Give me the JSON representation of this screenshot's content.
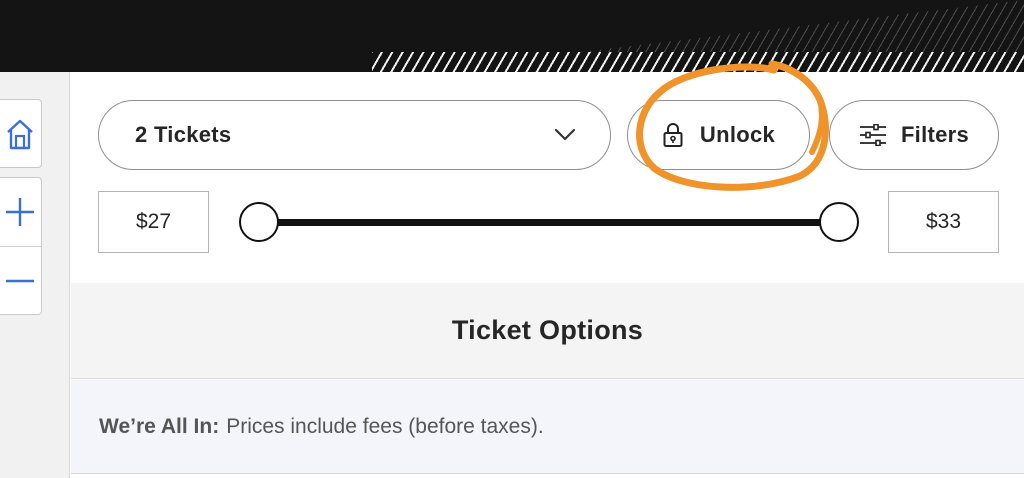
{
  "tickets_select": {
    "value": "2 Tickets",
    "icon": "chevron-down-icon"
  },
  "unlock_button": {
    "label": "Unlock",
    "icon": "lock-icon"
  },
  "filters_button": {
    "label": "Filters",
    "icon": "sliders-icon"
  },
  "price_range": {
    "min_label": "$27",
    "max_label": "$33",
    "min_value": 27,
    "max_value": 33
  },
  "map_controls": {
    "home_icon": "home-icon",
    "zoom_in_icon": "plus-icon",
    "zoom_out_icon": "minus-icon"
  },
  "ticket_options": {
    "title": "Ticket Options"
  },
  "fee_notice": {
    "strong": "We’re All In:",
    "text": "Prices include fees (before taxes)."
  },
  "colors": {
    "accent_blue": "#3b6fd8",
    "annotation_orange": "#f0932b",
    "header": "#141414"
  }
}
